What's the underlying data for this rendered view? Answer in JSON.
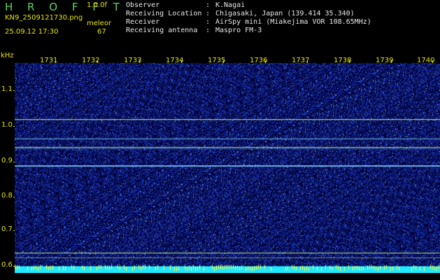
{
  "header": {
    "app_title": "H R O F F T",
    "app_version": "1.0.0f",
    "filename": "KN9_2509121730.png",
    "source_label": "meleor",
    "datetime": "25.09.12 17:30",
    "count": "67"
  },
  "metadata": [
    {
      "key": "Observer",
      "value": "K.Nagai"
    },
    {
      "key": "Receiving Location",
      "value": "Chigasaki, Japan (139.414 35.340)"
    },
    {
      "key": "Receiver",
      "value": "AirSpy mini (Miakejima VOR 108.65MHz)"
    },
    {
      "key": "Receiving antenna",
      "value": "Maspro FM-3"
    }
  ],
  "spectrogram": {
    "unit_label": "kHz",
    "freq_ticks": [
      "1.1",
      "1.0",
      "0.9",
      "0.8",
      "0.7",
      "0.6"
    ],
    "time_ticks": [
      "1731",
      "1732",
      "1733",
      "1734",
      "1735",
      "1736",
      "1737",
      "1738",
      "1739",
      "1740"
    ],
    "background_color": "#00003a",
    "noise_color": "#2a4cff",
    "signal_color": "#7fd0ff",
    "line_color": "#c8ff9a",
    "baseline_color": "#1fe8ff"
  }
}
